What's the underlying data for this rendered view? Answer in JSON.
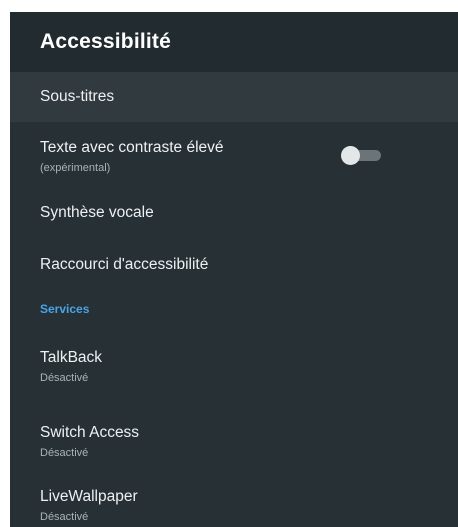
{
  "header": {
    "title": "Accessibilité"
  },
  "items": {
    "captions": {
      "label": "Sous-titres"
    },
    "high_contrast": {
      "label": "Texte avec contraste élevé",
      "sub": "(expérimental)",
      "enabled": false
    },
    "tts": {
      "label": "Synthèse vocale"
    },
    "shortcut": {
      "label": "Raccourci d'accessibilité"
    }
  },
  "services": {
    "section_label": "Services",
    "talkback": {
      "label": "TalkBack",
      "status": "Désactivé"
    },
    "switch_access": {
      "label": "Switch Access",
      "status": "Désactivé"
    },
    "livewallpaper": {
      "label": "LiveWallpaper",
      "status": "Désactivé"
    }
  },
  "colors": {
    "background": "#263035",
    "header": "#222b30",
    "focused_row": "#303a3f",
    "accent": "#4aa3e6"
  }
}
